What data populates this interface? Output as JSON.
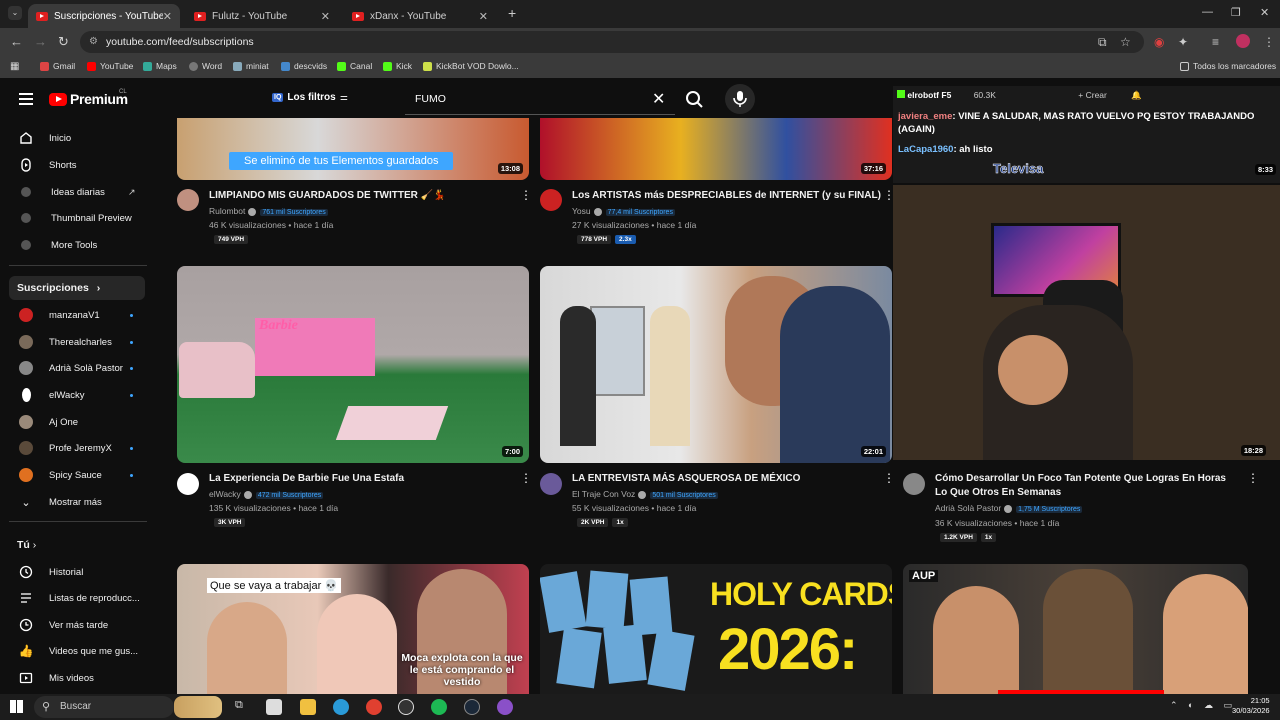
{
  "browser": {
    "tabs": [
      {
        "title": "Suscripciones - YouTube",
        "active": true
      },
      {
        "title": "Fulutz - YouTube",
        "active": false
      },
      {
        "title": "xDanx - YouTube",
        "active": false
      }
    ],
    "url": "youtube.com/feed/subscriptions",
    "bookmarks": [
      "Gmail",
      "YouTube",
      "Maps",
      "Word",
      "miniat",
      "descvids",
      "Canal",
      "Kick",
      "KickBot VOD Dowlo..."
    ],
    "all_bookmarks": "Todos los marcadores"
  },
  "masthead": {
    "logo_text": "Premium",
    "region": "CL",
    "filters_label": "Los filtros",
    "search_value": "FUMO"
  },
  "sidebar": {
    "main": [
      {
        "label": "Inicio",
        "icon": "home-icon"
      },
      {
        "label": "Shorts",
        "icon": "shorts-icon"
      },
      {
        "label": "Ideas diarias",
        "icon": "ideas-icon"
      },
      {
        "label": "Thumbnail Preview",
        "icon": "thumbnail-icon"
      },
      {
        "label": "More Tools",
        "icon": "tools-icon"
      }
    ],
    "subscriptions_title": "Suscripciones",
    "subscriptions": [
      {
        "name": "manzanaV1",
        "color": "#cc2222"
      },
      {
        "name": "Therealcharles",
        "color": "#7a6a5a"
      },
      {
        "name": "Adrià Solà Pastor",
        "color": "#888888"
      },
      {
        "name": "elWacky",
        "color": "#ffffff"
      },
      {
        "name": "Aj One",
        "color": "#9a8a7a"
      },
      {
        "name": "Profe JeremyX",
        "color": "#5a4a3a"
      },
      {
        "name": "Spicy Sauce",
        "color": "#e07020"
      }
    ],
    "show_more": "Mostrar más",
    "you_title": "Tú",
    "you_items": [
      {
        "label": "Historial",
        "icon": "history-icon"
      },
      {
        "label": "Listas de reproducc...",
        "icon": "playlist-icon"
      },
      {
        "label": "Ver más tarde",
        "icon": "watch-later-icon"
      },
      {
        "label": "Videos que me gus...",
        "icon": "like-icon"
      },
      {
        "label": "Mis videos",
        "icon": "my-videos-icon"
      }
    ]
  },
  "videos": [
    {
      "title": "LIMPIANDO MIS GUARDADOS DE TWITTER 🧹💃",
      "channel": "Rulombot",
      "subs": "761 mil Suscriptores",
      "meta": "46 K visualizaciones • hace 1 día",
      "vph": "749 VPH",
      "badge2": "",
      "duration": "13:08",
      "overlay": "Se eliminó de tus Elementos guardados"
    },
    {
      "title": "Los ARTISTAS más DESPRECIABLES de INTERNET (y su FINAL)",
      "channel": "Yosu",
      "subs": "77,4 mil Suscriptores",
      "meta": "27 K visualizaciones • hace 1 día",
      "vph": "778 VPH",
      "badge2": "2.3x",
      "duration": "37:16"
    },
    {
      "title": "La Experiencia De Barbie Fue Una Estafa",
      "channel": "elWacky",
      "subs": "472 mil Suscriptores",
      "meta": "135 K visualizaciones • hace 1 día",
      "vph": "3K VPH",
      "badge2": "",
      "duration": "7:00",
      "thumb_text": "Barbie"
    },
    {
      "title": "LA ENTREVISTA MÁS ASQUEROSA DE MÉXICO",
      "channel": "El Traje Con Voz",
      "subs": "501 mil Suscriptores",
      "meta": "55 K visualizaciones • hace 1 día",
      "vph": "2K VPH",
      "badge2": "1x",
      "duration": "22:01"
    },
    {
      "title": "Cómo Desarrollar Un Foco Tan Potente Que Logras En Horas Lo Que Otros En Semanas",
      "channel": "Adrià Solà Pastor",
      "subs": "1,75 M Suscriptores",
      "meta": "36 K visualizaciones • hace 1 día",
      "vph": "1.2K VPH",
      "badge2": "1x",
      "duration": "18:28"
    },
    {
      "thumb_text_top": "Que se vaya a trabajar 💀",
      "thumb_text_bottom": "Moca explota con la que le está comprando el vestido"
    },
    {
      "thumb_text_top": "HOLY CARDS",
      "thumb_text_bottom": "2026:",
      "card_label": "Holy Cards"
    },
    {
      "thumb_text_top": "AUP"
    }
  ],
  "stream": {
    "user": "elrobotf",
    "f5": "F5",
    "viewers": "60.3K",
    "create": "Crear",
    "chat": [
      {
        "user": "javiera_eme",
        "msg": ": VINE A SALUDAR, MAS RATO VUELVO PQ ESTOY TRABAJANDO (AGAIN)"
      },
      {
        "user": "LaCapa1960",
        "msg": ": ah listo"
      }
    ],
    "stream_label": "Televisa",
    "stream_dur": "8:33"
  },
  "taskbar": {
    "search": "Buscar",
    "time": "21:05",
    "date": "30/03/2026"
  }
}
